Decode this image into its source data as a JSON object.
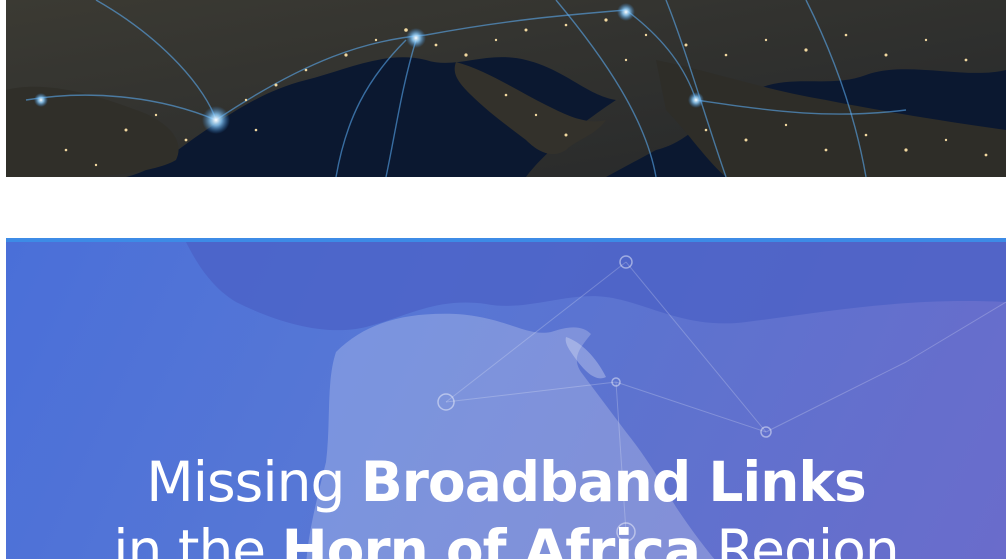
{
  "cards": [
    {
      "image_subject": "Night-time satellite view of Europe with glowing city lights and network connection lines"
    },
    {
      "image_subject": "Stylised map of the Horn of Africa region with network nodes",
      "title_line_1": {
        "light": "Missing ",
        "bold": "Broadband Links"
      },
      "title_line_2": {
        "light_1": "in the ",
        "bold": "Horn of Africa",
        "light_2": " Region"
      }
    }
  ],
  "colors": {
    "report_border": "#3d8be6",
    "report_gradient_start": "#4a6fd8",
    "report_gradient_end": "#6a6ccb",
    "night_sky": "#0a1426",
    "city_lights": "#f3d9a0",
    "network_lines": "#5fb4ff"
  }
}
